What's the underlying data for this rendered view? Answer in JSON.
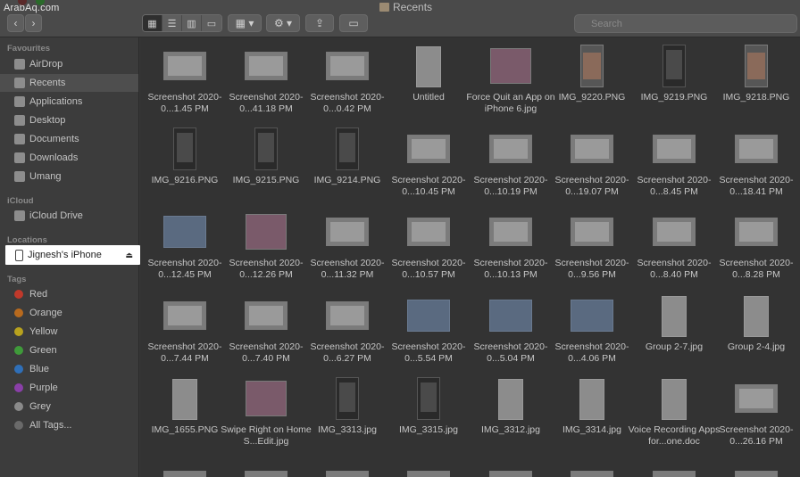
{
  "watermark": "ArabAq.com",
  "window": {
    "title": "Recents"
  },
  "toolbar": {
    "back_icon": "chevron-left-icon",
    "forward_icon": "chevron-right-icon",
    "search_placeholder": "Search"
  },
  "sidebar": {
    "favourites_label": "Favourites",
    "favourites": [
      {
        "label": "AirDrop",
        "icon": "airdrop-icon"
      },
      {
        "label": "Recents",
        "icon": "clock-icon",
        "selected": true
      },
      {
        "label": "Applications",
        "icon": "applications-icon"
      },
      {
        "label": "Desktop",
        "icon": "desktop-icon"
      },
      {
        "label": "Documents",
        "icon": "document-icon"
      },
      {
        "label": "Downloads",
        "icon": "download-icon"
      },
      {
        "label": "Umang",
        "icon": "folder-icon"
      }
    ],
    "icloud_label": "iCloud",
    "icloud": [
      {
        "label": "iCloud Drive",
        "icon": "cloud-icon"
      }
    ],
    "locations_label": "Locations",
    "locations": [
      {
        "label": "Jignesh's iPhone",
        "icon": "iphone-icon"
      }
    ],
    "tags_label": "Tags",
    "tags": [
      {
        "label": "Red",
        "color": "#c0392b"
      },
      {
        "label": "Orange",
        "color": "#b86a1e"
      },
      {
        "label": "Yellow",
        "color": "#b8a21e"
      },
      {
        "label": "Green",
        "color": "#3f9a3a"
      },
      {
        "label": "Blue",
        "color": "#2f6fb8"
      },
      {
        "label": "Purple",
        "color": "#8a3fa8"
      },
      {
        "label": "Grey",
        "color": "#8a8a8a"
      },
      {
        "label": "All Tags...",
        "color": "#6a6a6a"
      }
    ]
  },
  "files": [
    {
      "name": "Screenshot 2020-0...1.45 PM",
      "kind": "land"
    },
    {
      "name": "Screenshot 2020-0...41.18 PM",
      "kind": "land"
    },
    {
      "name": "Screenshot 2020-0...0.42 PM",
      "kind": "land"
    },
    {
      "name": "Untitled",
      "kind": "doc"
    },
    {
      "name": "Force Quit an App on iPhone 6.jpg",
      "kind": "gallery"
    },
    {
      "name": "IMG_9220.PNG",
      "kind": "photo"
    },
    {
      "name": "IMG_9219.PNG",
      "kind": "port"
    },
    {
      "name": "IMG_9218.PNG",
      "kind": "photo"
    },
    {
      "name": "IMG_9216.PNG",
      "kind": "port"
    },
    {
      "name": "IMG_9215.PNG",
      "kind": "port"
    },
    {
      "name": "IMG_9214.PNG",
      "kind": "port"
    },
    {
      "name": "Screenshot 2020-0...10.45 PM",
      "kind": "land"
    },
    {
      "name": "Screenshot 2020-0...10.19 PM",
      "kind": "land"
    },
    {
      "name": "Screenshot 2020-0...19.07 PM",
      "kind": "land"
    },
    {
      "name": "Screenshot 2020-0...8.45 PM",
      "kind": "land"
    },
    {
      "name": "Screenshot 2020-0...18.41 PM",
      "kind": "land"
    },
    {
      "name": "Screenshot 2020-0...12.45 PM",
      "kind": "app"
    },
    {
      "name": "Screenshot 2020-0...12.26 PM",
      "kind": "gallery"
    },
    {
      "name": "Screenshot 2020-0...11.32 PM",
      "kind": "land"
    },
    {
      "name": "Screenshot 2020-0...10.57 PM",
      "kind": "land"
    },
    {
      "name": "Screenshot 2020-0...10.13 PM",
      "kind": "land"
    },
    {
      "name": "Screenshot 2020-0...9.56 PM",
      "kind": "land"
    },
    {
      "name": "Screenshot 2020-0...8.40 PM",
      "kind": "land"
    },
    {
      "name": "Screenshot 2020-0...8.28 PM",
      "kind": "land"
    },
    {
      "name": "Screenshot 2020-0...7.44 PM",
      "kind": "land"
    },
    {
      "name": "Screenshot 2020-0...7.40 PM",
      "kind": "land"
    },
    {
      "name": "Screenshot 2020-0...6.27 PM",
      "kind": "land"
    },
    {
      "name": "Screenshot 2020-0...5.54 PM",
      "kind": "app"
    },
    {
      "name": "Screenshot 2020-0...5.04 PM",
      "kind": "app"
    },
    {
      "name": "Screenshot 2020-0...4.06 PM",
      "kind": "app"
    },
    {
      "name": "Group 2-7.jpg",
      "kind": "doc"
    },
    {
      "name": "Group 2-4.jpg",
      "kind": "doc"
    },
    {
      "name": "IMG_1655.PNG",
      "kind": "doc"
    },
    {
      "name": "Swipe Right on Home S...Edit.jpg",
      "kind": "gallery"
    },
    {
      "name": "IMG_3313.jpg",
      "kind": "port"
    },
    {
      "name": "IMG_3315.jpg",
      "kind": "port"
    },
    {
      "name": "IMG_3312.jpg",
      "kind": "doc"
    },
    {
      "name": "IMG_3314.jpg",
      "kind": "doc"
    },
    {
      "name": "Voice Recording Apps for...one.doc",
      "kind": "doc"
    },
    {
      "name": "Screenshot 2020-0...26.16 PM",
      "kind": "land"
    }
  ]
}
